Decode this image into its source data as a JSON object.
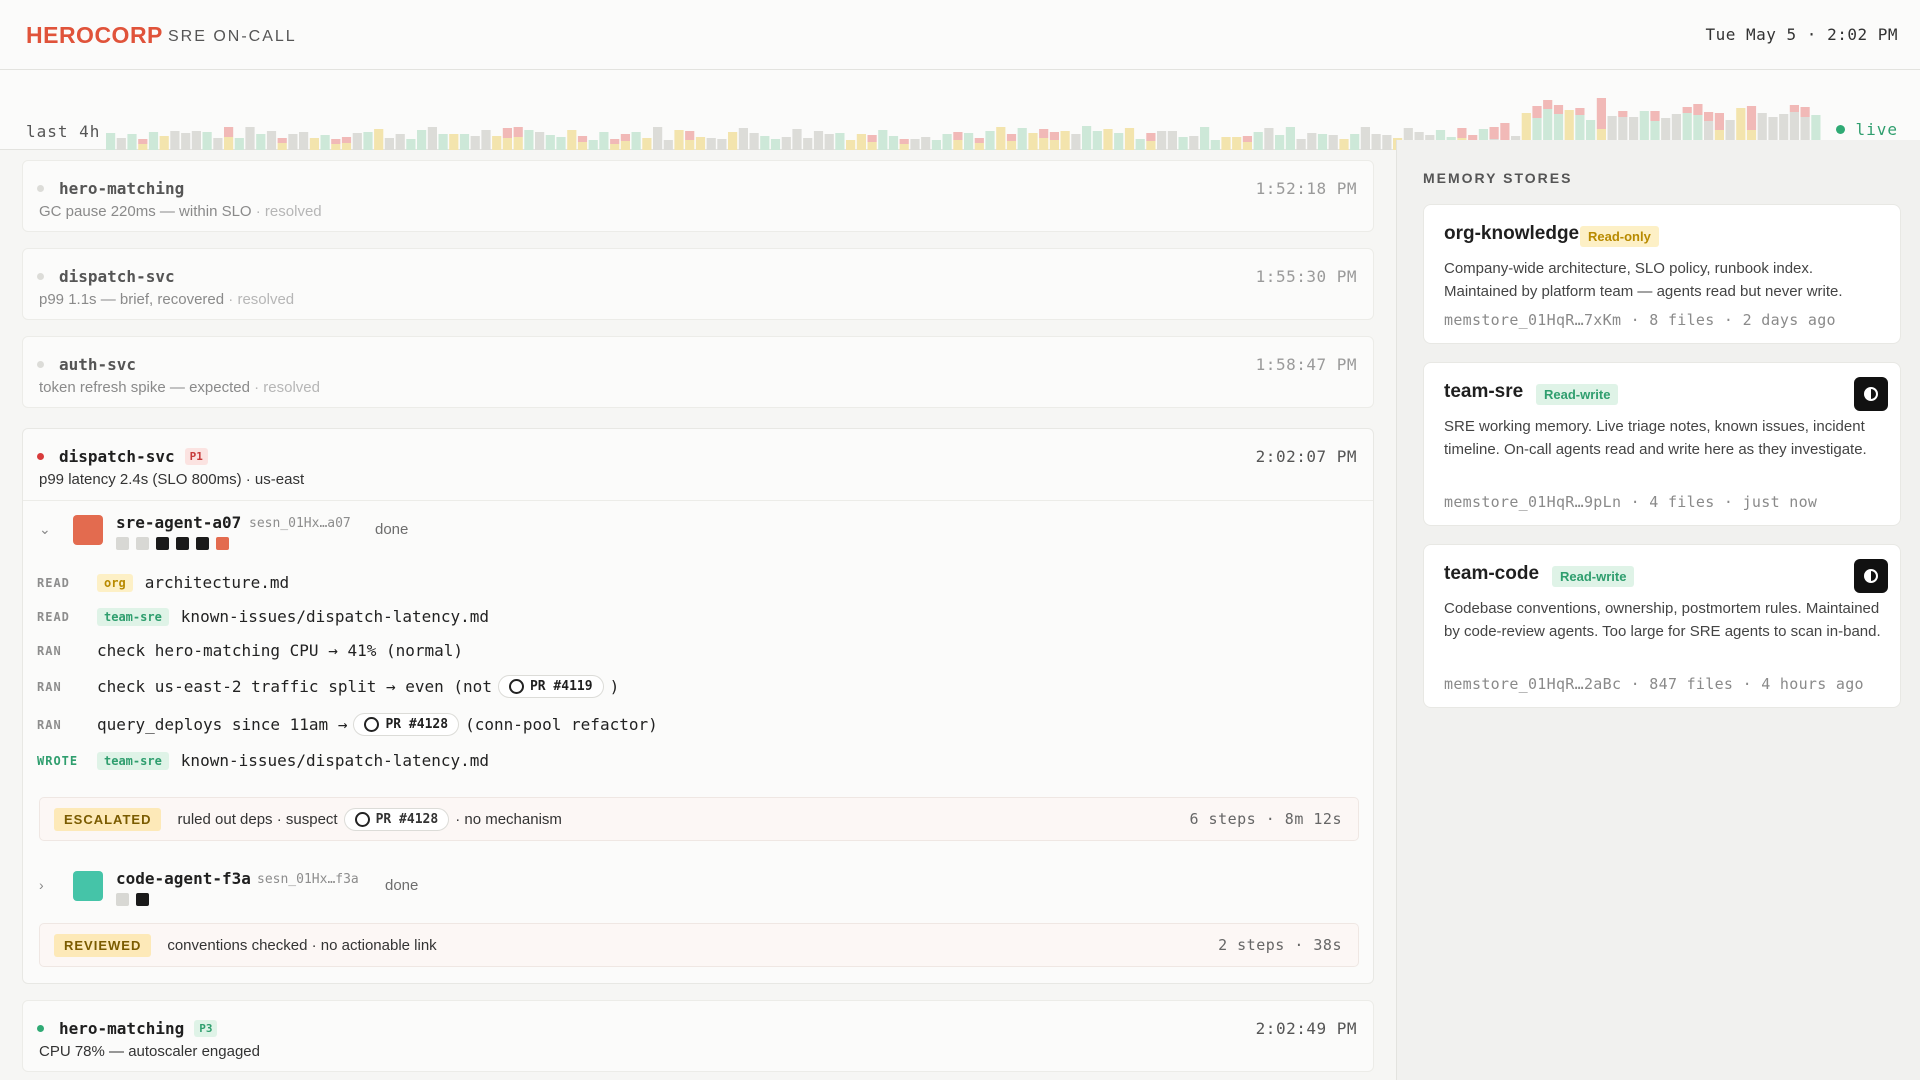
{
  "header": {
    "brand": "HEROCORP",
    "subtitle": "SRE ON-CALL",
    "clock": "Tue May 5 · 2:02 PM"
  },
  "activity": {
    "label": "last 4h",
    "live_label": "live",
    "colors": {
      "gray": "#dcdcd8",
      "green": "#cde8d8",
      "yellow": "#f3e4ad",
      "red": "#f1b9b7"
    }
  },
  "feed": [
    {
      "service": "hero-matching",
      "detail": "GC pause 220ms — within SLO",
      "status": "· resolved",
      "time": "1:52:18 PM"
    },
    {
      "service": "dispatch-svc",
      "detail": "p99 1.1s — brief, recovered",
      "status": "· resolved",
      "time": "1:55:30 PM"
    },
    {
      "service": "auth-svc",
      "detail": "token refresh spike — expected",
      "status": "· resolved",
      "time": "1:58:47 PM"
    }
  ],
  "incident": {
    "service": "dispatch-svc",
    "priority": "P1",
    "detail": "p99 latency 2.4s (SLO 800ms) · us-east",
    "time": "2:02:07 PM",
    "agent1": {
      "chevron": "⌄",
      "name": "sre-agent-a07",
      "session": "sesn_01Hx…a07",
      "status": "done",
      "logs": {
        "l1": {
          "verb": "READ",
          "tag": "org",
          "text": "architecture.md"
        },
        "l2": {
          "verb": "READ",
          "tag": "team-sre",
          "text": "known-issues/dispatch-latency.md"
        },
        "l3": {
          "verb": "RAN",
          "text": "check hero-matching CPU → 41% (normal)"
        },
        "l4": {
          "verb": "RAN",
          "text_a": "check us-east-2 traffic split → even (not",
          "pr": "PR #4119",
          "text_b": ")"
        },
        "l5": {
          "verb": "RAN",
          "text_a": "query_deploys since 11am →",
          "pr": "PR #4128",
          "text_b": "(conn-pool refactor)"
        },
        "l6": {
          "verb": "WROTE",
          "tag": "team-sre",
          "text": "known-issues/dispatch-latency.md"
        }
      },
      "banner": {
        "badge": "ESCALATED",
        "text_a": "ruled out deps · suspect",
        "pr": "PR #4128",
        "text_b": "· no mechanism",
        "meta": "6 steps · 8m 12s"
      }
    },
    "agent2": {
      "chevron": "›",
      "name": "code-agent-f3a",
      "session": "sesn_01Hx…f3a",
      "status": "done",
      "banner": {
        "badge": "REVIEWED",
        "text": "conventions checked · no actionable link",
        "meta": "2 steps · 38s"
      }
    }
  },
  "bottom_incident": {
    "service": "hero-matching",
    "priority": "P3",
    "detail": "CPU 78% — autoscaler engaged",
    "time": "2:02:49 PM"
  },
  "memory": {
    "title": "MEMORY STORES",
    "stores": [
      {
        "name": "org-knowledge",
        "perm": "Read-only",
        "desc": "Company-wide architecture, SLO policy, runbook index. Maintained by platform team — agents read but never write.",
        "meta": "memstore_01HqR…7xKm · 8 files · 2 days ago"
      },
      {
        "name": "team-sre",
        "perm": "Read-write",
        "desc": "SRE working memory. Live triage notes, known issues, incident timeline. On-call agents read and write here as they investigate.",
        "meta": "memstore_01HqR…9pLn · 4 files · just now"
      },
      {
        "name": "team-code",
        "perm": "Read-write",
        "desc": "Codebase conventions, ownership, postmortem rules. Maintained by code-review agents. Too large for SRE agents to scan in-band.",
        "meta": "memstore_01HqR…2aBc · 847 files · 4 hours ago"
      }
    ]
  }
}
